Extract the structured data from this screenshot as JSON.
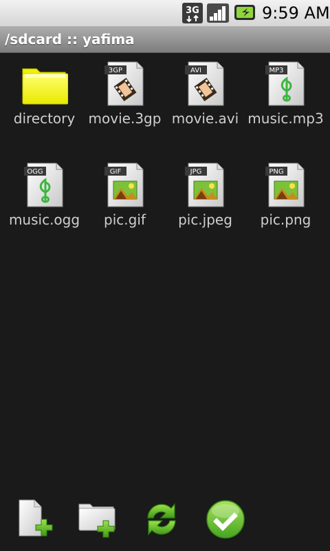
{
  "status_bar": {
    "network": "3G",
    "time": "9:59 AM"
  },
  "title_bar": {
    "title": "/sdcard :: yafima"
  },
  "files": [
    {
      "label": "directory",
      "type": "folder",
      "icon": "folder-icon"
    },
    {
      "label": "movie.3gp",
      "type": "video",
      "badge": "3GP",
      "icon": "video-file-icon"
    },
    {
      "label": "movie.avi",
      "type": "video",
      "badge": "AVI",
      "icon": "video-file-icon"
    },
    {
      "label": "music.mp3",
      "type": "audio",
      "badge": "MP3",
      "icon": "audio-file-icon"
    },
    {
      "label": "music.ogg",
      "type": "audio",
      "badge": "OGG",
      "icon": "audio-file-icon"
    },
    {
      "label": "pic.gif",
      "type": "image",
      "badge": "GIF",
      "icon": "image-file-icon"
    },
    {
      "label": "pic.jpeg",
      "type": "image",
      "badge": "JPG",
      "icon": "image-file-icon"
    },
    {
      "label": "pic.png",
      "type": "image",
      "badge": "PNG",
      "icon": "image-file-icon"
    }
  ],
  "toolbar": [
    {
      "action": "new-file",
      "icon": "new-file-icon"
    },
    {
      "action": "new-folder",
      "icon": "new-folder-icon"
    },
    {
      "action": "refresh",
      "icon": "refresh-icon"
    },
    {
      "action": "confirm",
      "icon": "checkmark-icon"
    }
  ],
  "colors": {
    "background": "#1a1a1a",
    "label": "#cfcfcf",
    "folder": "#f5f500",
    "accent_green": "#4db82a"
  }
}
